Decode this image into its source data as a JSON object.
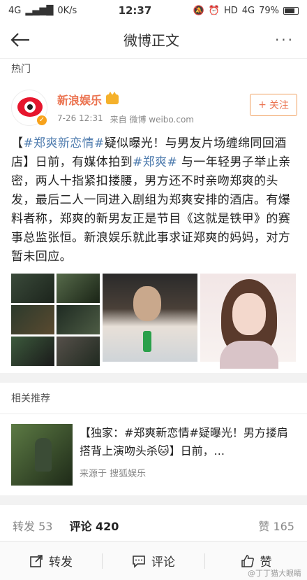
{
  "statusbar": {
    "network": "4G",
    "speed": "0K/s",
    "time": "12:37",
    "hd": "HD",
    "network2": "4G",
    "battery": "79%"
  },
  "navbar": {
    "title": "微博正文",
    "more": "···"
  },
  "section_hot": "热门",
  "post": {
    "author": "新浪娱乐",
    "avatar_text": "新浪娱乐",
    "time": "7-26 12:31",
    "source": "来自 微博 weibo.com",
    "follow": "关注",
    "text_parts": [
      {
        "t": "【",
        "hl": false
      },
      {
        "t": "#郑爽新恋情#",
        "hl": true
      },
      {
        "t": "疑似曝光！与男友片场缠绵同回酒店】日前，有媒体拍到",
        "hl": false
      },
      {
        "t": "#郑爽#",
        "hl": true
      },
      {
        "t": " 与一年轻男子举止亲密，两人十指紧扣搂腰，男方还不时亲吻郑爽的头发，最后二人一同进入剧组为郑爽安排的酒店。有爆料者称，郑爽的新男友正是节目《这就是铁甲》的赛事总监张恒。新浪娱乐就此事求证郑爽的妈妈，对方暂未回应。",
        "hl": false
      }
    ]
  },
  "related": {
    "label": "相关推荐",
    "title": "【独家：#郑爽新恋情#疑曝光！男方搂肩搭背上演吻头杀🐱】日前，...",
    "source": "来源于 搜狐娱乐"
  },
  "tabs": {
    "repost": "转发 53",
    "comment": "评论 420",
    "like": "赞 165"
  },
  "bottombar": {
    "repost": "转发",
    "comment": "评论",
    "like": "赞"
  },
  "watermark": "@丁丁猫大眼睛",
  "colors": {
    "author": "#eb7350",
    "hashtag": "#507daf",
    "accent": "#ff6600"
  }
}
